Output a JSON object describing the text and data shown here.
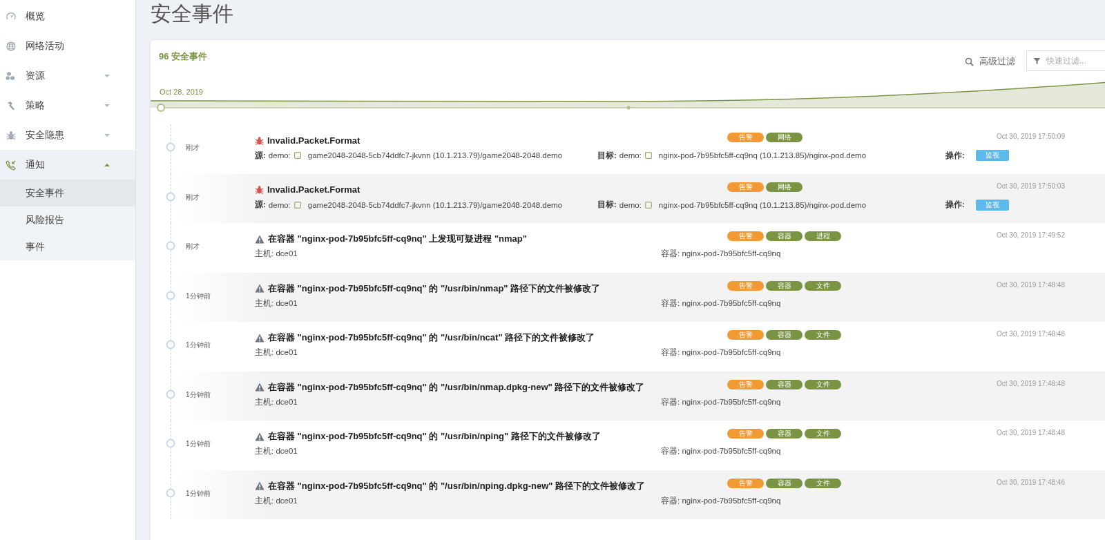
{
  "sidebar": {
    "items": [
      {
        "label": "概览",
        "selected": false
      },
      {
        "label": "网络活动",
        "selected": false
      },
      {
        "label": "资源",
        "selected": false,
        "expanded": false
      },
      {
        "label": "策略",
        "selected": false,
        "expanded": false
      },
      {
        "label": "安全隐患",
        "selected": false,
        "expanded": false
      },
      {
        "label": "通知",
        "selected": true,
        "expanded": true,
        "children": [
          {
            "label": "安全事件",
            "selected": true
          },
          {
            "label": "风险报告",
            "selected": false
          },
          {
            "label": "事件",
            "selected": false
          }
        ]
      }
    ]
  },
  "page_title": "安全事件",
  "panel": {
    "count_title": "96 安全事件",
    "advanced_filter": "高级过滤",
    "quick_filter": {
      "placeholder": "快速过滤..."
    },
    "timeline_chart": {
      "start_label": "Oct 28, 2019"
    },
    "events": [
      {
        "kind": "network",
        "time_ago": "刚才",
        "title": "Invalid.Packet.Format",
        "tags": [
          {
            "label": "告警",
            "color": "#f09a33"
          },
          {
            "label": "网络",
            "color": "#7b9444"
          }
        ],
        "timestamp": "Oct 30, 2019 17:50:09",
        "source_label": "源:",
        "source_ns": "demo:",
        "source": "game2048-2048-5cb74ddfc7-jkvnn (10.1.213.79)/game2048-2048.demo",
        "target_label": "目标:",
        "target_ns": "demo:",
        "target": "nginx-pod-7b95bfc5ff-cq9nq (10.1.213.85)/nginx-pod.demo",
        "action_label": "操作:",
        "action_button": "监视"
      },
      {
        "kind": "network",
        "time_ago": "刚才",
        "title": "Invalid.Packet.Format",
        "tags": [
          {
            "label": "告警",
            "color": "#f09a33"
          },
          {
            "label": "网络",
            "color": "#7b9444"
          }
        ],
        "timestamp": "Oct 30, 2019 17:50:03",
        "source_label": "源:",
        "source_ns": "demo:",
        "source": "game2048-2048-5cb74ddfc7-jkvnn (10.1.213.79)/game2048-2048.demo",
        "target_label": "目标:",
        "target_ns": "demo:",
        "target": "nginx-pod-7b95bfc5ff-cq9nq (10.1.213.85)/nginx-pod.demo",
        "action_label": "操作:",
        "action_button": "监视"
      },
      {
        "kind": "container",
        "time_ago": "刚才",
        "title": "在容器 \"nginx-pod-7b95bfc5ff-cq9nq\" 上发现可疑进程 \"nmap\"",
        "tags": [
          {
            "label": "告警",
            "color": "#f09a33"
          },
          {
            "label": "容器",
            "color": "#7b9444"
          },
          {
            "label": "进程",
            "color": "#7b9444"
          }
        ],
        "timestamp": "Oct 30, 2019 17:49:52",
        "host": "主机: dce01",
        "container": "容器: nginx-pod-7b95bfc5ff-cq9nq"
      },
      {
        "kind": "container",
        "time_ago": "1分钟前",
        "title": "在容器 \"nginx-pod-7b95bfc5ff-cq9nq\" 的 \"/usr/bin/nmap\" 路径下的文件被修改了",
        "tags": [
          {
            "label": "告警",
            "color": "#f09a33"
          },
          {
            "label": "容器",
            "color": "#7b9444"
          },
          {
            "label": "文件",
            "color": "#7b9444"
          }
        ],
        "timestamp": "Oct 30, 2019 17:48:48",
        "host": "主机: dce01",
        "container": "容器: nginx-pod-7b95bfc5ff-cq9nq"
      },
      {
        "kind": "container",
        "time_ago": "1分钟前",
        "title": "在容器 \"nginx-pod-7b95bfc5ff-cq9nq\" 的 \"/usr/bin/ncat\" 路径下的文件被修改了",
        "tags": [
          {
            "label": "告警",
            "color": "#f09a33"
          },
          {
            "label": "容器",
            "color": "#7b9444"
          },
          {
            "label": "文件",
            "color": "#7b9444"
          }
        ],
        "timestamp": "Oct 30, 2019 17:48:48",
        "host": "主机: dce01",
        "container": "容器: nginx-pod-7b95bfc5ff-cq9nq"
      },
      {
        "kind": "container",
        "time_ago": "1分钟前",
        "title": "在容器 \"nginx-pod-7b95bfc5ff-cq9nq\" 的 \"/usr/bin/nmap.dpkg-new\" 路径下的文件被修改了",
        "tags": [
          {
            "label": "告警",
            "color": "#f09a33"
          },
          {
            "label": "容器",
            "color": "#7b9444"
          },
          {
            "label": "文件",
            "color": "#7b9444"
          }
        ],
        "timestamp": "Oct 30, 2019 17:48:48",
        "host": "主机: dce01",
        "container": "容器: nginx-pod-7b95bfc5ff-cq9nq"
      },
      {
        "kind": "container",
        "time_ago": "1分钟前",
        "title": "在容器 \"nginx-pod-7b95bfc5ff-cq9nq\" 的 \"/usr/bin/nping\" 路径下的文件被修改了",
        "tags": [
          {
            "label": "告警",
            "color": "#f09a33"
          },
          {
            "label": "容器",
            "color": "#7b9444"
          },
          {
            "label": "文件",
            "color": "#7b9444"
          }
        ],
        "timestamp": "Oct 30, 2019 17:48:48",
        "host": "主机: dce01",
        "container": "容器: nginx-pod-7b95bfc5ff-cq9nq"
      },
      {
        "kind": "container",
        "time_ago": "1分钟前",
        "title": "在容器 \"nginx-pod-7b95bfc5ff-cq9nq\" 的 \"/usr/bin/nping.dpkg-new\" 路径下的文件被修改了",
        "tags": [
          {
            "label": "告警",
            "color": "#f09a33"
          },
          {
            "label": "容器",
            "color": "#7b9444"
          },
          {
            "label": "文件",
            "color": "#7b9444"
          }
        ],
        "timestamp": "Oct 30, 2019 17:48:46",
        "host": "主机: dce01",
        "container": "容器: nginx-pod-7b95bfc5ff-cq9nq"
      }
    ]
  }
}
